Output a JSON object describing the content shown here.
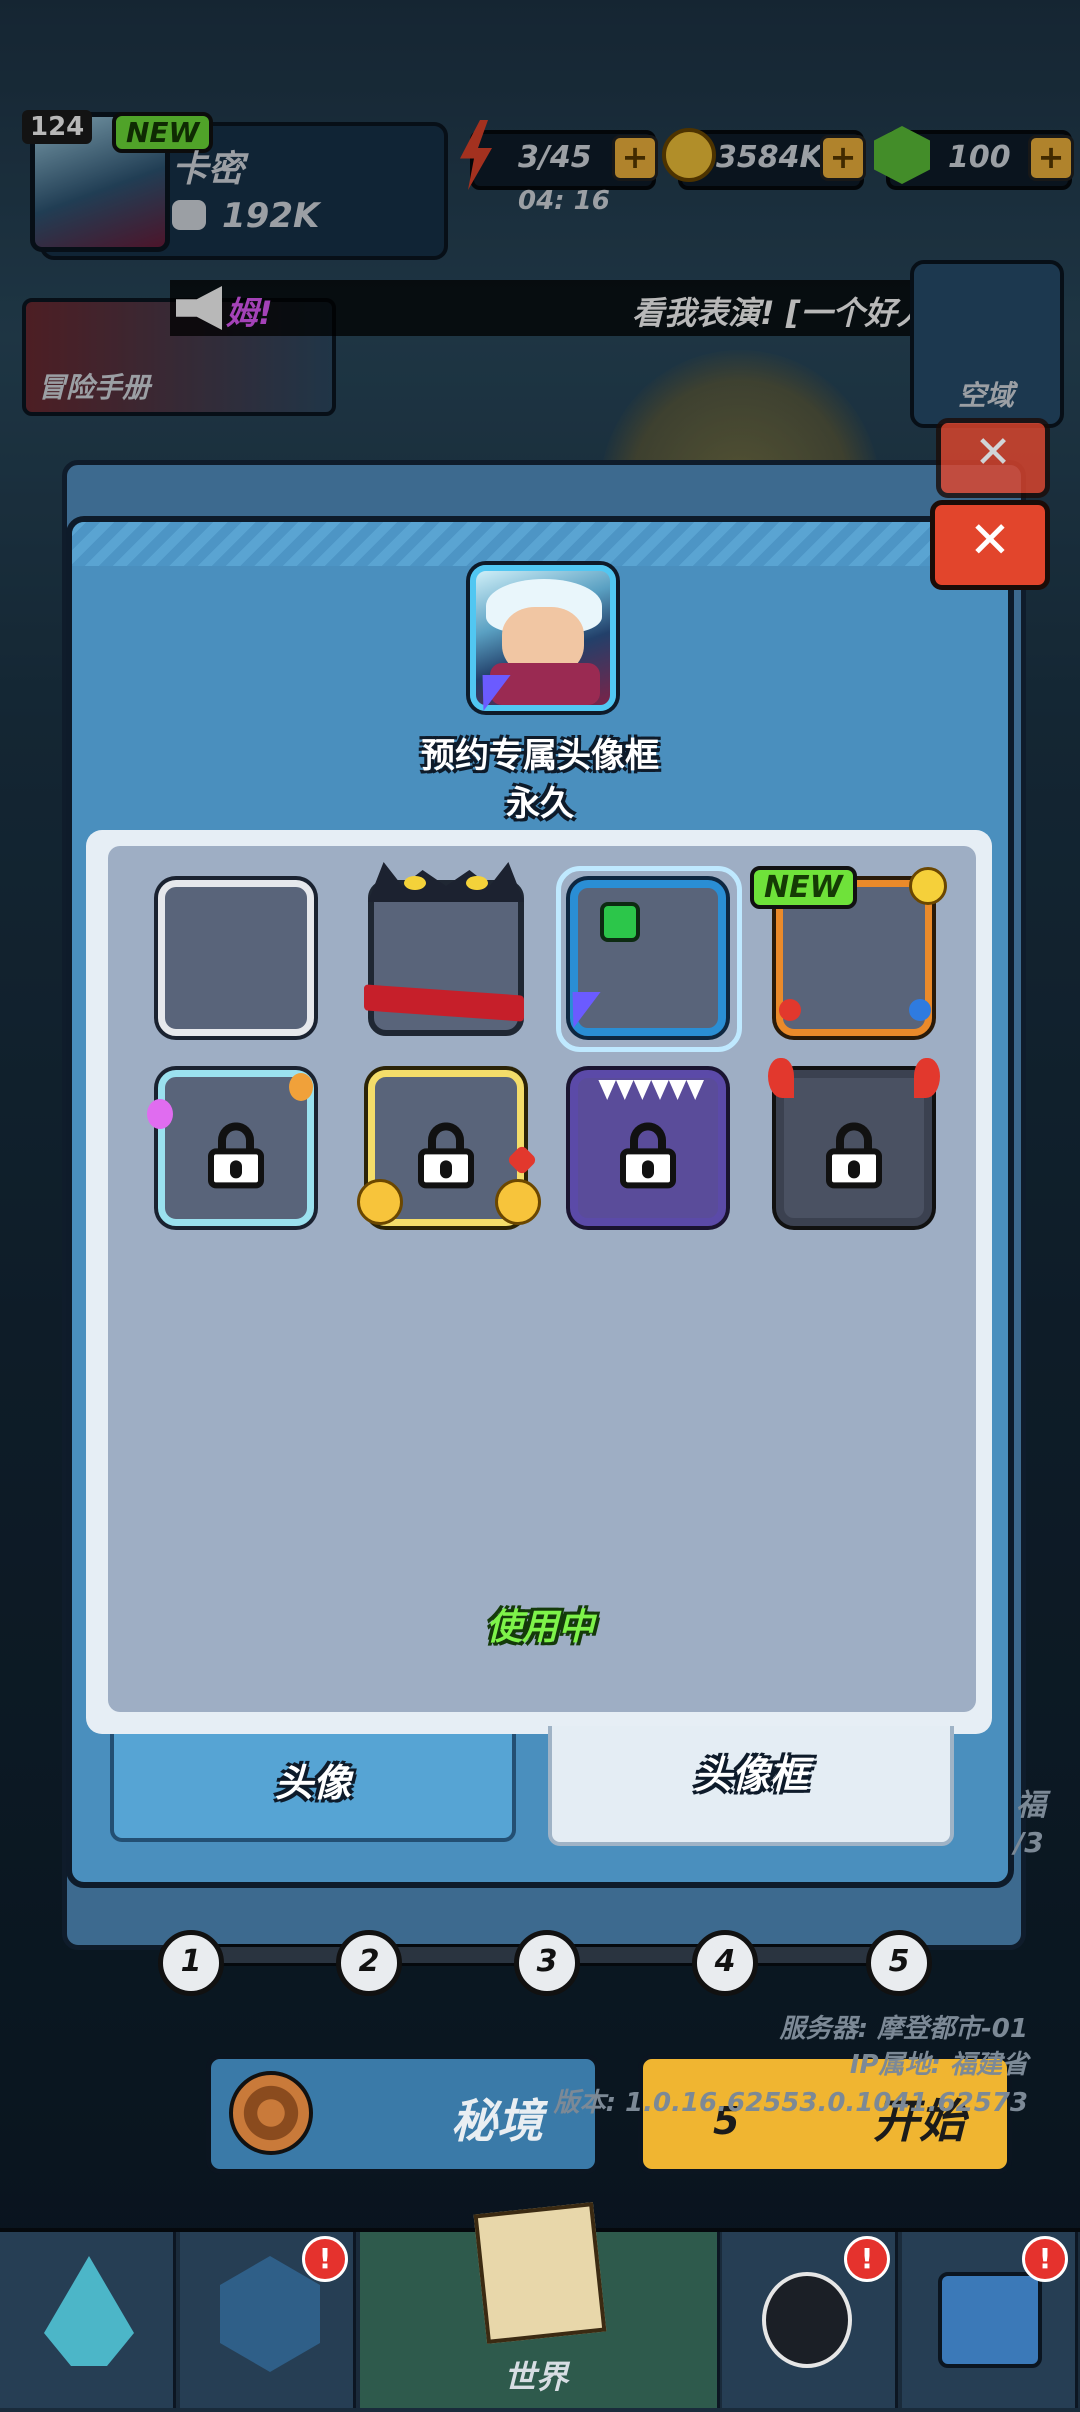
{
  "hud": {
    "level": "124",
    "new_badge": "NEW",
    "player_name": "卡密",
    "power": "192K",
    "energy": "3/45",
    "timer": "04: 16",
    "coins": "3584K",
    "gems": "100",
    "plus": "+"
  },
  "marquee": {
    "left_text": "姆!",
    "right_text": "看我表演! [一个好人"
  },
  "adventure_book": "冒险手册",
  "side_button": "空域",
  "close_label": "✕",
  "popup": {
    "selected_frame_name": "预约专属头像框",
    "selected_frame_duration": "永久",
    "new_badge": "NEW",
    "status": "使用中",
    "tabs": [
      {
        "label": "头像",
        "active": false
      },
      {
        "label": "头像框",
        "active": true
      }
    ],
    "frames": [
      {
        "name": "default-frame",
        "locked": false
      },
      {
        "name": "demon-eyes-frame",
        "locked": false
      },
      {
        "name": "reservation-frame",
        "locked": false,
        "selected": true
      },
      {
        "name": "arcade-frame",
        "locked": false,
        "new": true
      },
      {
        "name": "balloon-frame",
        "locked": true
      },
      {
        "name": "heart-hands-frame",
        "locked": true
      },
      {
        "name": "purple-monster-frame",
        "locked": true
      },
      {
        "name": "horned-demon-frame",
        "locked": true
      }
    ]
  },
  "game": {
    "stages": [
      "1",
      "2",
      "3",
      "4",
      "5"
    ],
    "server": "服务器: 摩登都市-01",
    "ip": "IP属地: 福建省",
    "version": "版本: 1.0.16.62553.0.1041.62573",
    "secret_realm": "秘境",
    "start": "开始",
    "start_cost": "5",
    "side_right": "福",
    "side_right_count": "/3"
  },
  "bottom_nav": {
    "world": "世界",
    "alert": "!"
  },
  "colors": {
    "popup_blue": "#4a8fbe",
    "new_green": "#6fe23a",
    "using_green": "#7ef34a",
    "close_red": "#e2452c"
  }
}
